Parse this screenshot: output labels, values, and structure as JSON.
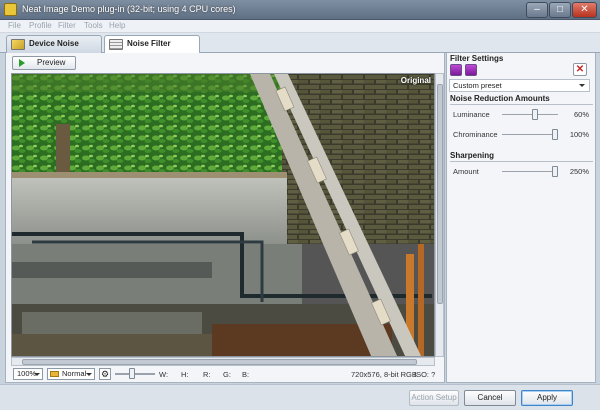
{
  "window": {
    "title": "Neat Image Demo plug-in (32-bit; using 4 CPU cores)",
    "minimize": "–",
    "maximize": "□",
    "close": "✕"
  },
  "menu": [
    "File",
    "Profile",
    "Filter",
    "Tools",
    "Help"
  ],
  "tabs": [
    {
      "label": "Device Noise Profile",
      "icon": "profile-icon",
      "active": false
    },
    {
      "label": "Noise Filter Settings",
      "icon": "filter-settings-icon",
      "active": true
    }
  ],
  "preview": {
    "button_label": "Preview",
    "overlay_label": "Original"
  },
  "statusbar": {
    "zoom": "100%",
    "blend_mode": "Normal",
    "settings_icon": "⚙",
    "w_label": "W:",
    "h_label": "H:",
    "r_label": "R:",
    "g_label": "G:",
    "b_label": "B:",
    "image_info": "720x576, 8-bit RGB",
    "iso_label": "ISO: ?"
  },
  "filter_settings": {
    "title": "Filter Settings",
    "preset": "Custom preset",
    "delete_icon": "✕"
  },
  "noise_reduction": {
    "title": "Noise Reduction Amounts",
    "params": [
      {
        "label": "Luminance",
        "value": "60%",
        "level": 0.6
      },
      {
        "label": "Chrominance",
        "value": "100%",
        "level": 1.0
      }
    ]
  },
  "sharpening": {
    "title": "Sharpening",
    "params": [
      {
        "label": "Amount",
        "value": "250%",
        "level": 1.0
      }
    ]
  },
  "buttons": {
    "action_setup": "Action Setup",
    "cancel": "Cancel",
    "apply": "Apply"
  },
  "colors": {
    "accent": "#3f84c8",
    "titlebar": "#6b7a8e"
  }
}
